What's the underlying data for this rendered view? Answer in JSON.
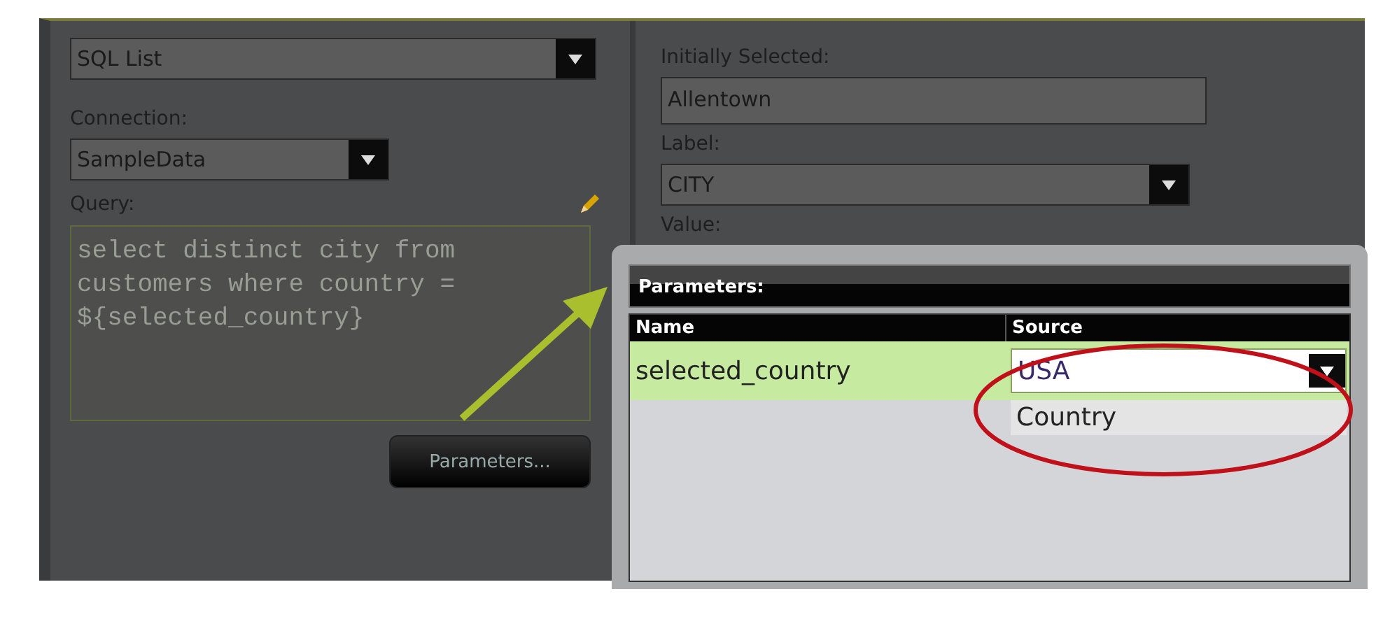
{
  "left": {
    "type_dropdown": {
      "value": "SQL List"
    },
    "connection": {
      "label": "Connection:",
      "value": "SampleData"
    },
    "query": {
      "label": "Query:",
      "value": "select distinct city from customers where country = ${selected_country}"
    },
    "parameters_button": "Parameters..."
  },
  "right": {
    "initially_selected": {
      "label": "Initially Selected:",
      "value": "Allentown"
    },
    "label_field": {
      "label": "Label:",
      "value": "CITY"
    },
    "value_label": "Value:"
  },
  "dialog": {
    "title": "Parameters:",
    "columns": [
      "Name",
      "Source"
    ],
    "rows": [
      {
        "name": "selected_country",
        "source": "USA",
        "selected": true
      }
    ],
    "open_options": [
      {
        "label": "Country",
        "selected": false
      }
    ]
  }
}
